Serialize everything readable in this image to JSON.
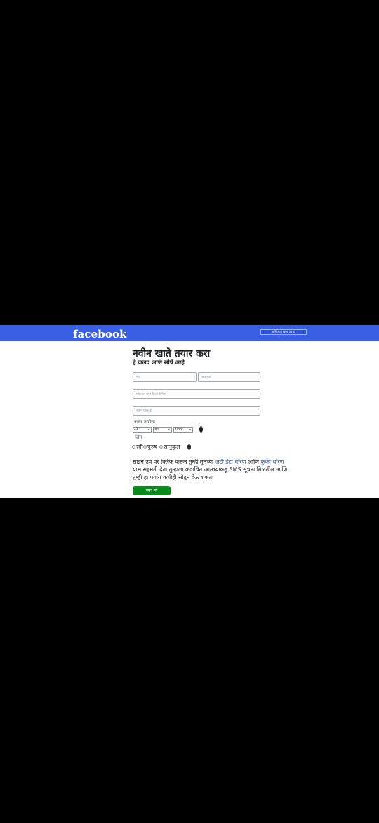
{
  "header": {
    "logo": "facebook",
    "top_link": "अस्तित्वात खाता उघ डा"
  },
  "form": {
    "title": "नवीन खाते तयार करा",
    "subtitle": "हे जलद आणे सोपे आहे",
    "first_name_placeholder": "नाव",
    "last_name_placeholder": "आडनाव",
    "contact_placeholder": "मोबाइल नंबर किंवा ई-मेल",
    "password_placeholder": "नवीन पासवर्ड",
    "birthday_label": "जन्म तारीख",
    "birthday": {
      "day": "21",
      "month": "जून",
      "year": "2000"
    },
    "gender_label": "लिंग",
    "gender_options": [
      "स्त्री",
      "पुरुष",
      "सानुकूल"
    ],
    "help_glyph": "?",
    "terms": {
      "t1": "साइन उप वर क्लिक करून तुम्ही तुमच्या ",
      "link1": "अटी डेटा धोरण",
      "t2": " आणि ",
      "link2": "कुकी धोरण",
      "t3": " यास सहमती देता तुम्हाला कदाचित आमच्याकडू SMS सूचना मिळतील आणि तुम्ही हा पर्याय कधीही सोडून देऊ शकता"
    },
    "signup_label": "साइन अप"
  },
  "colors": {
    "brand_blue": "#3b5fe3",
    "signup_green": "#0a8a1c",
    "link_blue": "#385898"
  }
}
